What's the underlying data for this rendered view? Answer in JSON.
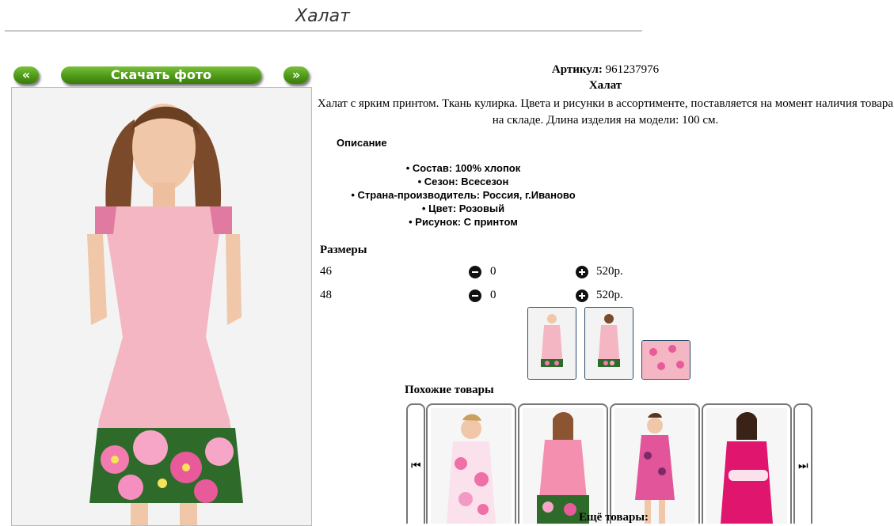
{
  "page": {
    "title": "Халат"
  },
  "gallery": {
    "prev_label": "«",
    "download_label": "Скачать фото",
    "next_label": "»"
  },
  "product": {
    "article_label": "Артикул:",
    "article_value": "961237976",
    "name": "Халат",
    "description": "Халат с ярким принтом. Ткань кулирка. Цвета и рисунки в ассортименте, поставляется на момент наличия товара на складе. Длина изделия на модели: 100 см.",
    "description_heading": "Описание",
    "properties": [
      "Состав: 100% хлопок",
      "Сезон: Всесезон",
      "Страна-производитель: Россия, г.Иваново",
      "Цвет: Розовый",
      "Рисунок: С принтом"
    ],
    "sizes_heading": "Размеры",
    "sizes": [
      {
        "size": "46",
        "qty": "0",
        "price": "520р."
      },
      {
        "size": "48",
        "qty": "0",
        "price": "520р."
      }
    ]
  },
  "similar": {
    "heading": "Похожие товары",
    "prev_icon": "⏮",
    "next_icon": "⏭",
    "more_label": "Ещё товары:"
  },
  "colors": {
    "button_green": "#5aa51f",
    "dress_pink": "#f4b6c2",
    "thumb_border": "#2b4a6b"
  }
}
